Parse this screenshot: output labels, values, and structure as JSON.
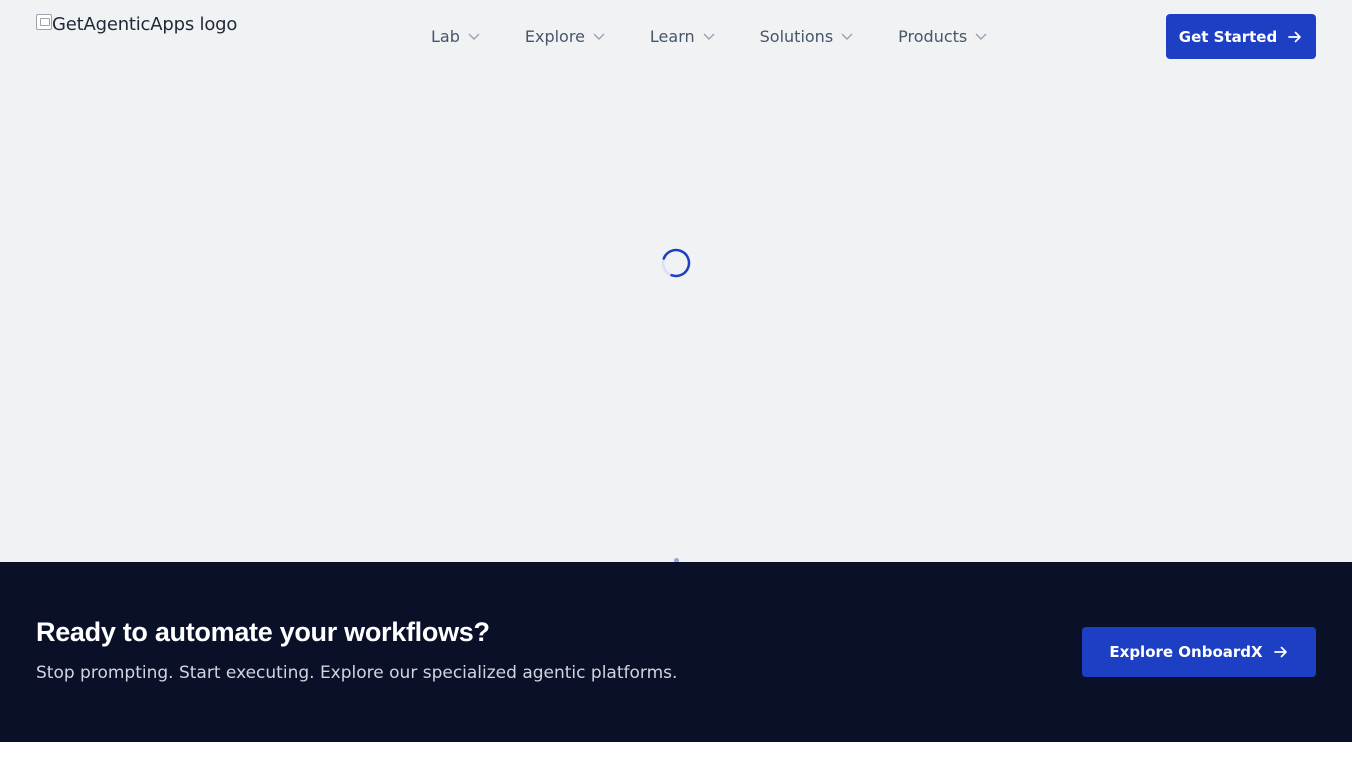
{
  "header": {
    "logo_alt": "GetAgenticApps logo",
    "nav": [
      {
        "label": "Lab"
      },
      {
        "label": "Explore"
      },
      {
        "label": "Learn"
      },
      {
        "label": "Solutions"
      },
      {
        "label": "Products"
      }
    ],
    "cta_label": "Get Started"
  },
  "cta_section": {
    "title": "Ready to automate your workflows?",
    "subtitle": "Stop prompting. Start executing. Explore our specialized agentic platforms.",
    "button_label": "Explore OnboardX"
  },
  "colors": {
    "accent": "#1d3fc4",
    "page_background": "#f1f2f4",
    "cta_background": "#0b1029"
  },
  "icons": {
    "nav_chevron": "chevron-down-icon",
    "button_arrow": "arrow-right-icon",
    "loader": "loading-spinner-icon",
    "broken_image": "broken-image-icon"
  }
}
